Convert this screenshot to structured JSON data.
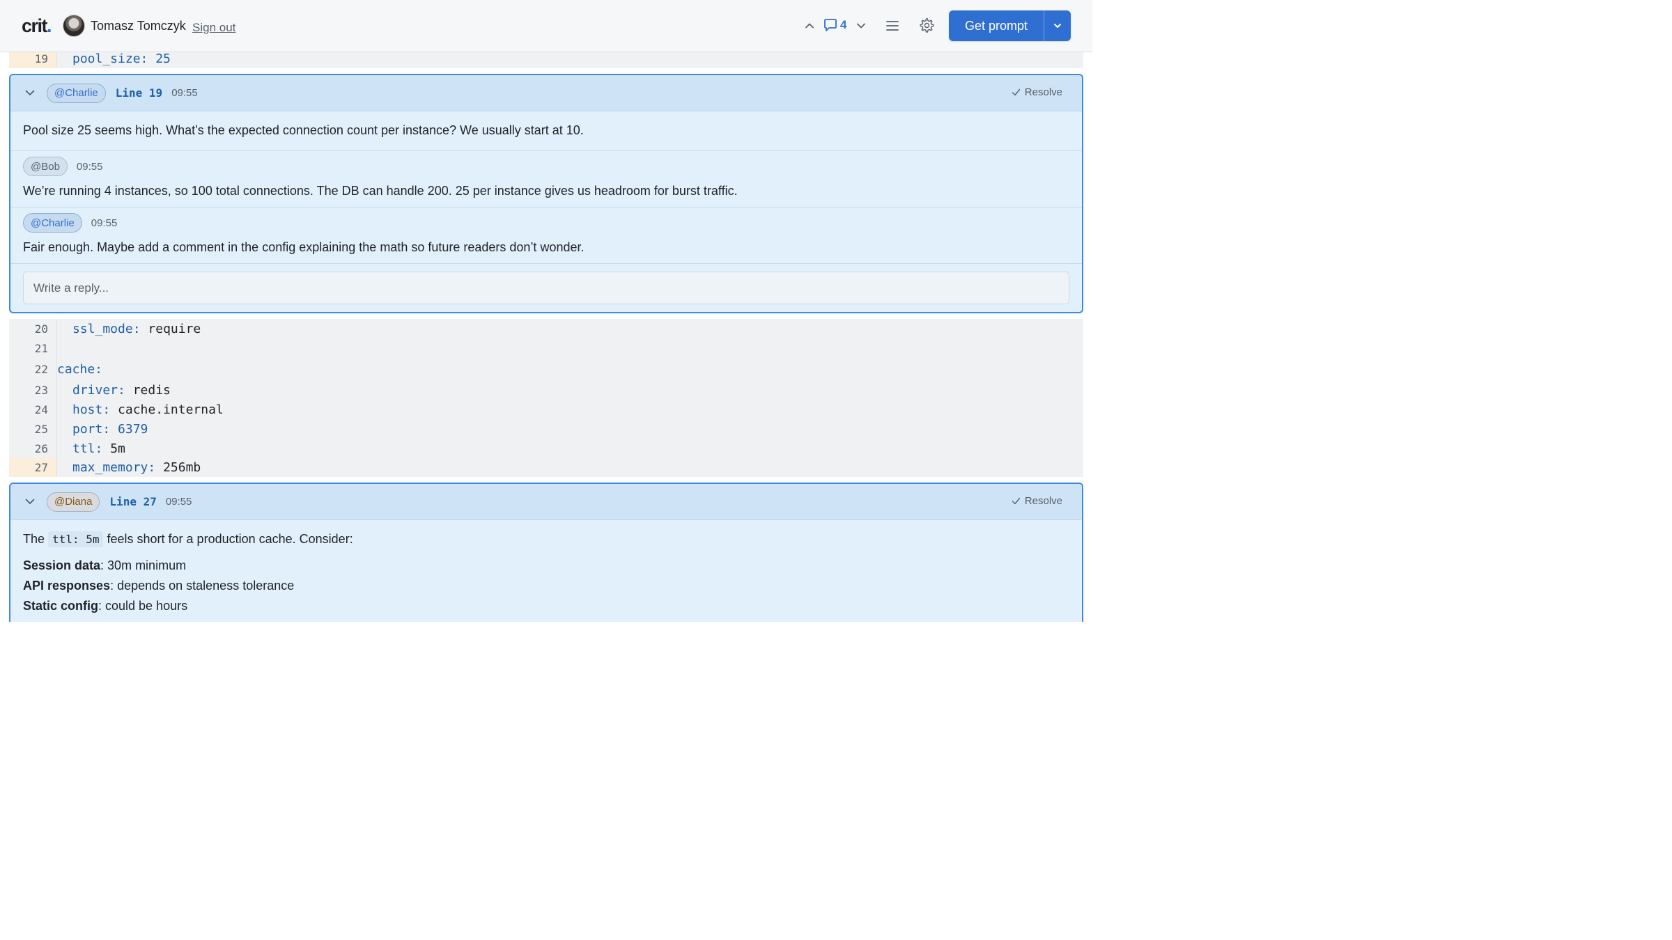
{
  "app": {
    "logo": "crit",
    "logo_dot": "."
  },
  "user": {
    "name": "Tomasz Tomczyk",
    "sign_out": "Sign out"
  },
  "nav": {
    "comment_count": "4"
  },
  "actions": {
    "get_prompt": "Get prompt"
  },
  "code_top": [
    {
      "line": "19",
      "key": "pool_size:",
      "value": "25",
      "value_kind": "num",
      "indent": true
    }
  ],
  "thread1": {
    "author": "@Charlie",
    "line_label": "Line 19",
    "time": "09:55",
    "resolve": "Resolve",
    "body": "Pool size 25 seems high. What’s the expected connection count per instance? We usually start at 10.",
    "replies": [
      {
        "author": "@Bob",
        "time": "09:55",
        "body": "We’re running 4 instances, so 100 total connections. The DB can handle 200. 25 per instance gives us headroom for burst traffic."
      },
      {
        "author": "@Charlie",
        "time": "09:55",
        "body": "Fair enough. Maybe add a comment in the config explaining the math so future readers don’t wonder."
      }
    ],
    "reply_placeholder": "Write a reply..."
  },
  "code_mid": [
    {
      "line": "20",
      "key": "ssl_mode:",
      "value": "require"
    },
    {
      "line": "21",
      "key": "",
      "value": ""
    },
    {
      "line": "22",
      "key": "cache:",
      "value": ""
    },
    {
      "line": "23",
      "key": "driver:",
      "value": "redis"
    },
    {
      "line": "24",
      "key": "host:",
      "value": "cache.internal"
    },
    {
      "line": "25",
      "key": "port:",
      "value": "6379"
    },
    {
      "line": "26",
      "key": "ttl:",
      "value": "5m"
    },
    {
      "line": "27",
      "key": "max_memory:",
      "value": "256mb"
    }
  ],
  "thread2": {
    "author": "@Diana",
    "line_label": "Line 27",
    "time": "09:55",
    "resolve": "Resolve",
    "body_prefix": "The",
    "body_code": "ttl: 5m",
    "body_suffix": "feels short for a production cache. Consider:",
    "items": [
      {
        "label": "Session data",
        "text": ": 30m minimum"
      },
      {
        "label": "API responses",
        "text": ": depends on staleness tolerance"
      },
      {
        "label": "Static config",
        "text": ": could be hours"
      }
    ]
  },
  "icons": {
    "nav_up": "chevron-up-icon",
    "comment": "comment-bubble-icon",
    "nav_down": "chevron-down-icon",
    "menu": "hamburger-menu-icon",
    "settings": "gear-icon",
    "collapse": "chevron-down-icon",
    "resolve": "check-icon"
  },
  "colors": {
    "accent": "#2f6fd1",
    "thread_border": "#3d8ae0",
    "thread_bg": "#e2f0fc",
    "highlight_gutter": "#fbeedb"
  }
}
